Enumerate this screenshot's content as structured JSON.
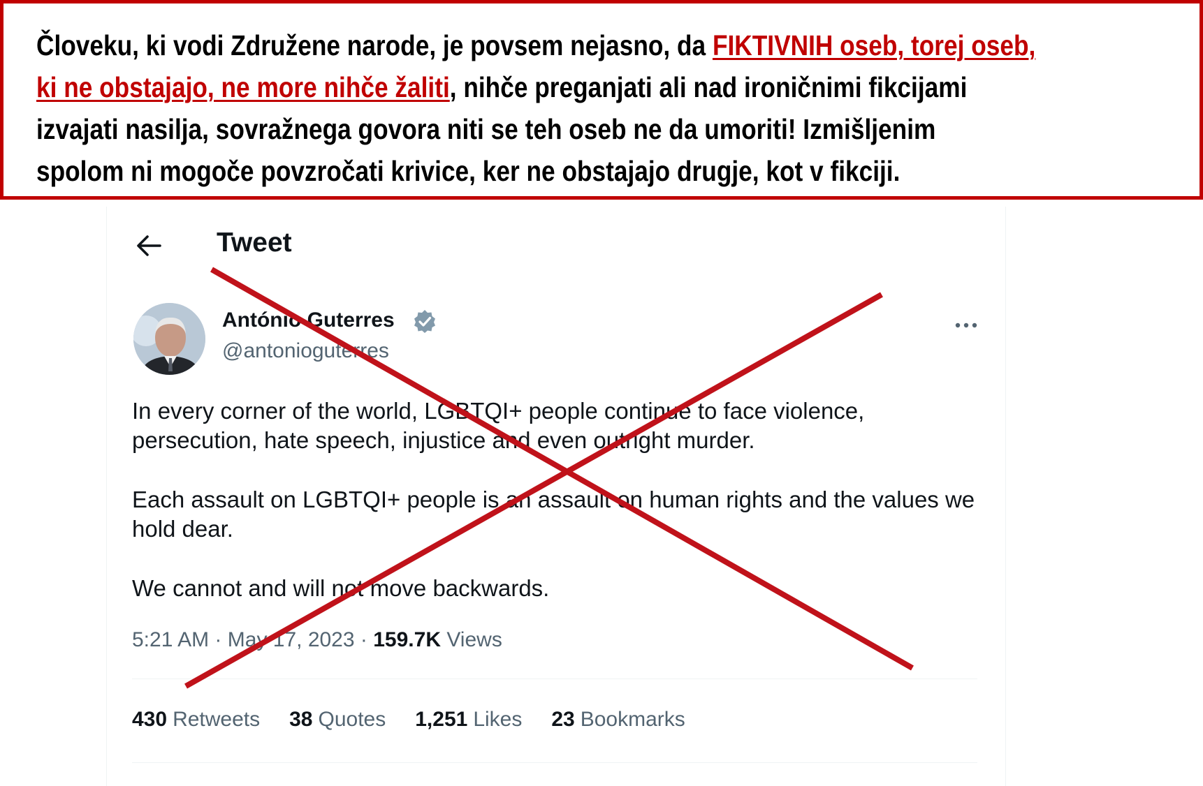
{
  "banner": {
    "part1": "Človeku, ki vodi Združene narode, je povsem nejasno, da ",
    "highlight1": "FIKTIVNIH oseb, torej oseb,",
    "highlight2": "ki ne obstajajo, ne more nihče žaliti",
    "part2": ", nihče preganjati ali nad ironičnimi fikcijami",
    "line3": "izvajati nasilja, sovražnega govora niti se teh oseb ne da umoriti!  Izmišljenim",
    "line4": "spolom ni mogoče povzročati krivice, ker ne obstajajo drugje, kot v fikciji.",
    "accent_color": "#c00000"
  },
  "header": {
    "title": "Tweet",
    "back_icon": "arrow-left-icon"
  },
  "author": {
    "name": "António Guterres",
    "handle": "@antonioguterres",
    "verified_icon": "verified-badge-icon",
    "verified_color": "#829aab"
  },
  "tweet": {
    "paragraphs": [
      "In every corner of the world, LGBTQI+ people continue to face violence, persecution, hate speech, injustice and even outright murder.",
      "Each assault on LGBTQI+ people is an assault on human rights and the values we hold dear.",
      "We cannot and will not move backwards."
    ],
    "time": "5:21 AM",
    "separator": "·",
    "date": "May 17, 2023",
    "views_count": "159.7K",
    "views_label": "Views"
  },
  "stats": [
    {
      "count": "430",
      "label": "Retweets"
    },
    {
      "count": "38",
      "label": "Quotes"
    },
    {
      "count": "1,251",
      "label": "Likes"
    },
    {
      "count": "23",
      "label": "Bookmarks"
    }
  ],
  "overlay": {
    "cross_color": "#c0121a"
  }
}
